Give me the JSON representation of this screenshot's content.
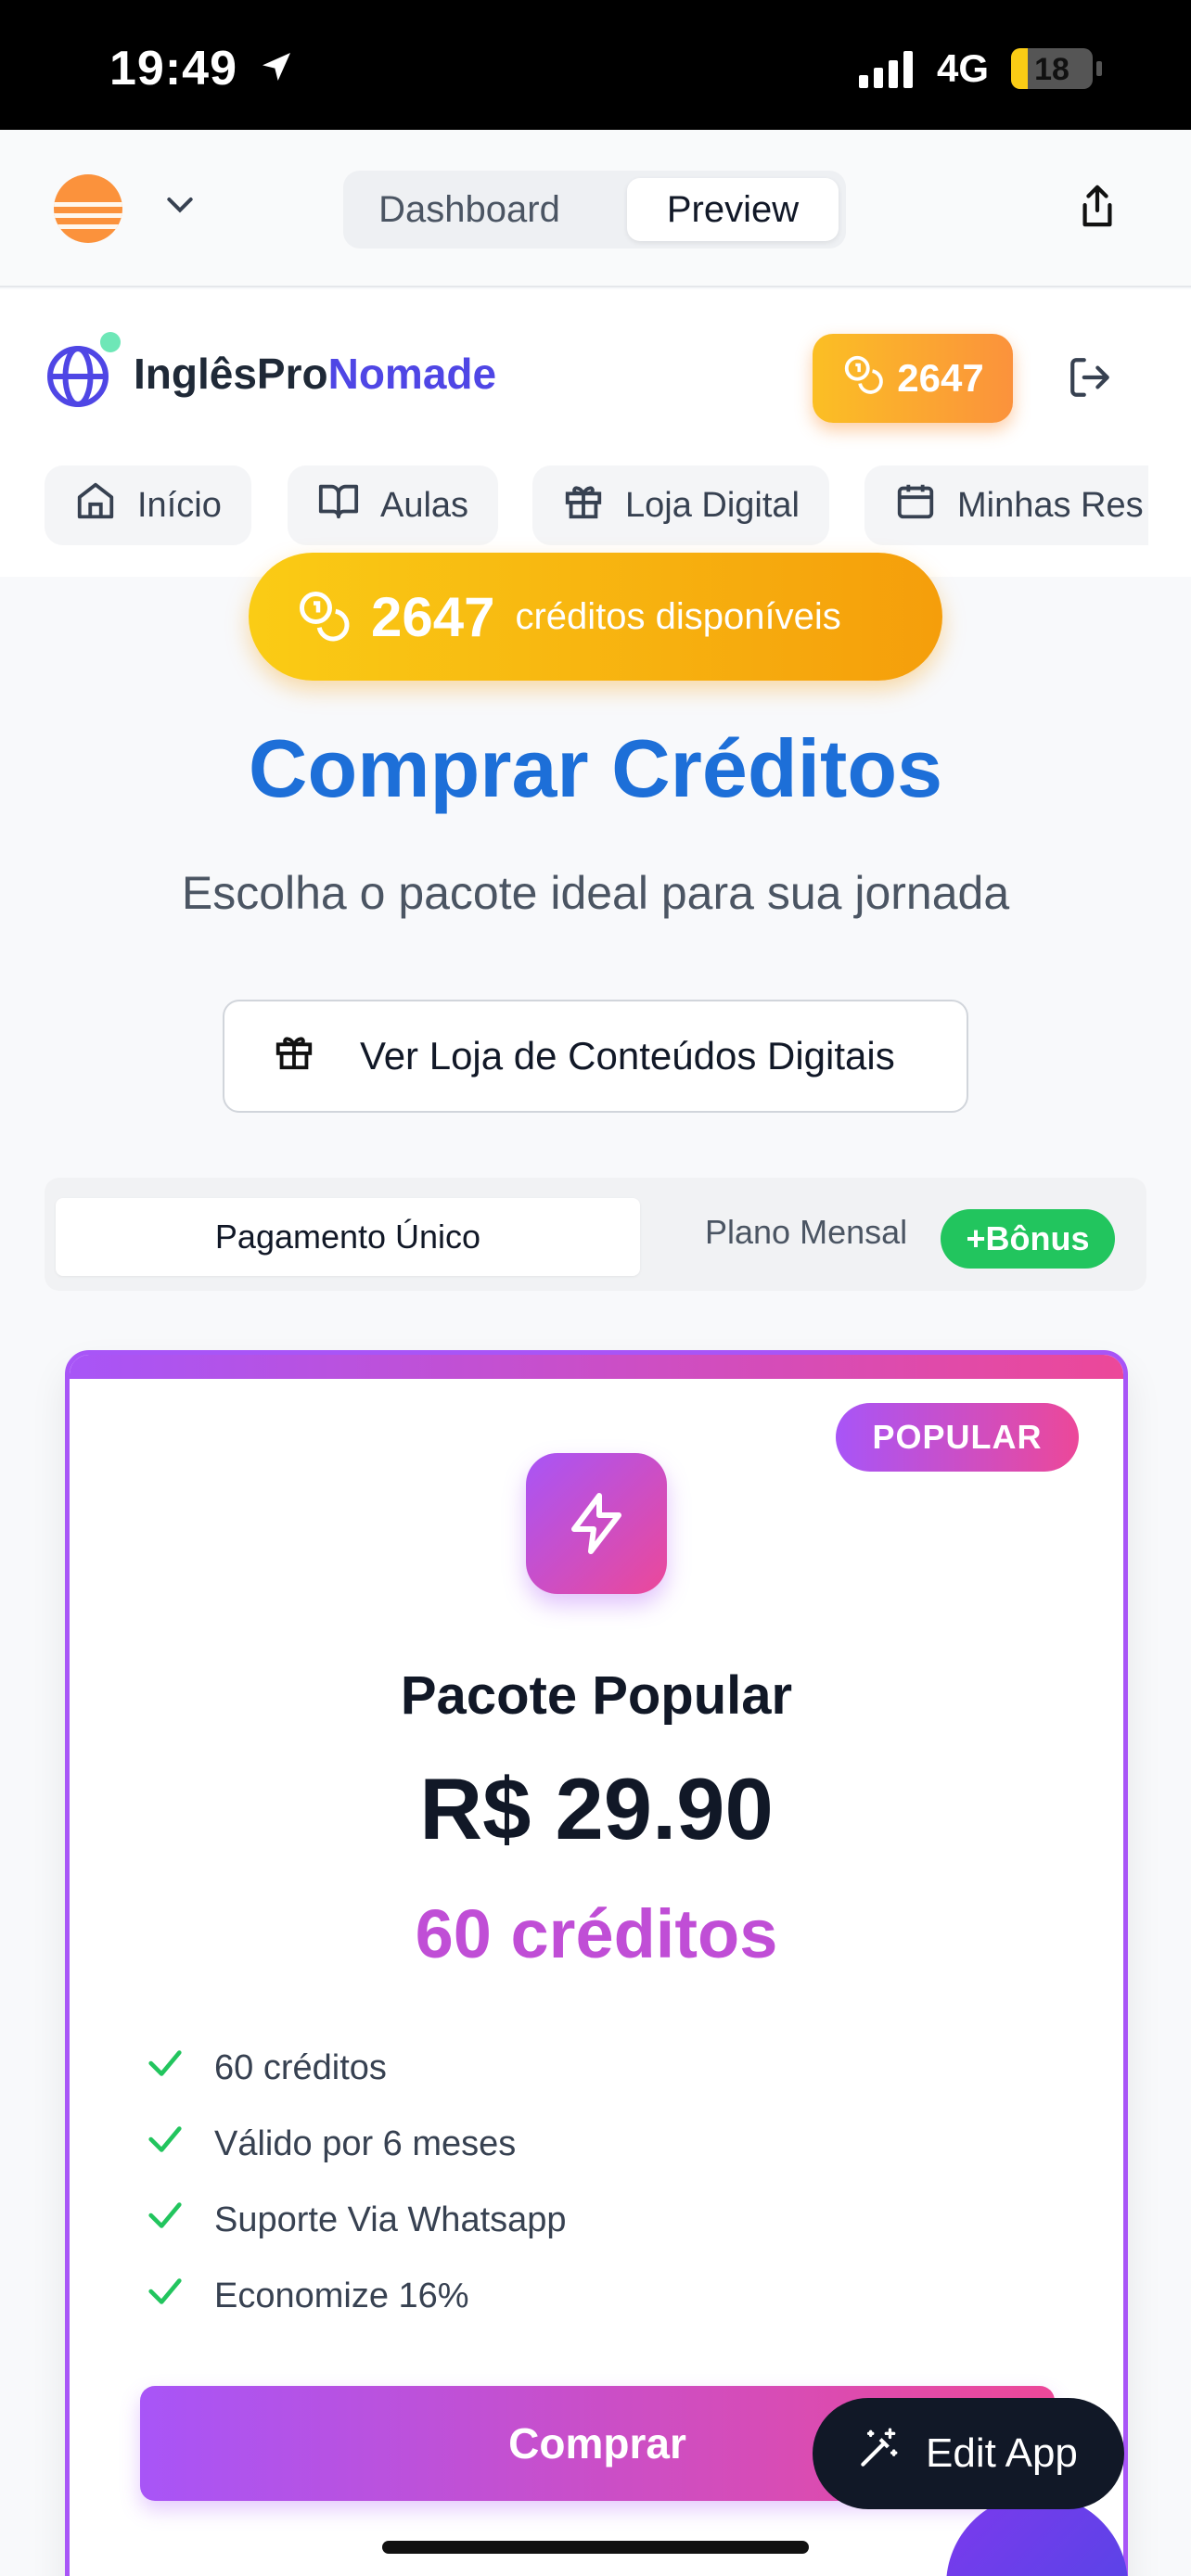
{
  "status_bar": {
    "time": "19:49",
    "network": "4G",
    "battery": "18"
  },
  "app_header": {
    "tabs": {
      "dashboard": "Dashboard",
      "preview": "Preview"
    }
  },
  "site_nav": {
    "brand_main": "InglêsPro",
    "brand_accent": "Nomade",
    "credits": "2647",
    "tabs": [
      "Início",
      "Aulas",
      "Loja Digital",
      "Minhas Res"
    ]
  },
  "balance": {
    "amount": "2647",
    "label": "créditos disponíveis"
  },
  "page": {
    "title": "Comprar Créditos",
    "subtitle": "Escolha o pacote ideal para sua jornada",
    "store_button": "Ver Loja de Conteúdos Digitais"
  },
  "payment_toggle": {
    "once": "Pagamento Único",
    "monthly": "Plano Mensal",
    "bonus": "+Bônus"
  },
  "plan": {
    "badge": "POPULAR",
    "name": "Pacote Popular",
    "price": "R$ 29.90",
    "credits": "60 créditos",
    "features": [
      "60 créditos",
      "Válido por 6 meses",
      "Suporte Via Whatsapp",
      "Economize 16%"
    ],
    "buy": "Comprar"
  },
  "floating": {
    "edit_app": "Edit App"
  },
  "colors": {
    "accent": "#4f46e5",
    "gold": "#f59e0b",
    "purple": "#a855f7",
    "pink": "#ec4899",
    "green": "#22c55e",
    "title_blue": "#1d6fd8"
  }
}
